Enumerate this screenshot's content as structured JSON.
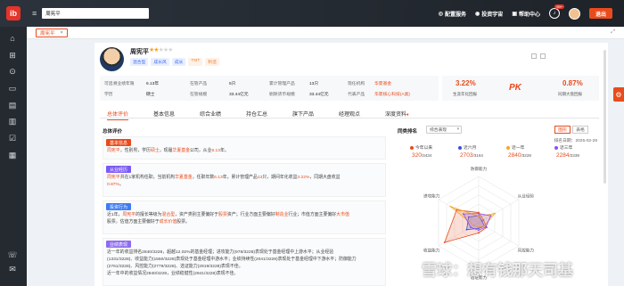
{
  "top": {
    "search_value": "周宪平",
    "links": [
      {
        "icon": "target-icon",
        "label": "配置服务"
      },
      {
        "icon": "globe-icon",
        "label": "投资宇宙"
      },
      {
        "icon": "chart-icon",
        "label": "帮助中心"
      }
    ],
    "bell_count": "99+",
    "exit_label": "退出",
    "colors": {
      "brand": "#e84b1c",
      "topbar": "#2c333c",
      "sidebar": "#252a31"
    }
  },
  "leftnav": {
    "icons": [
      "home-icon",
      "app-grid-icon",
      "compass-icon",
      "screen-icon",
      "folder-icon",
      "report-icon",
      "check-list-icon",
      "clipboard-icon",
      "phone-icon",
      "chat-icon"
    ]
  },
  "page_tab": {
    "label": "周宪平"
  },
  "manager": {
    "name": "周宪平",
    "rating": 2,
    "rating_max": 5,
    "tags": [
      "混合型",
      "成长风",
      "成长",
      "TMT",
      "制造"
    ],
    "info": {
      "row1": [
        {
          "label": "可追溯业绩年限",
          "value": "6.13年"
        },
        {
          "label": "在管产品",
          "value": "5只"
        },
        {
          "label": "累计管理产品",
          "value": "13只"
        },
        {
          "label": "现任机构",
          "value": "华夏基金"
        }
      ],
      "row2": [
        {
          "label": "学历",
          "value": "硕士"
        },
        {
          "label": "在管规模",
          "value": "33.44亿元"
        },
        {
          "label": "剔除货币规模",
          "value": "33.44亿元"
        },
        {
          "label": "代表产品",
          "value": "华夏核心科技(A类)"
        }
      ]
    },
    "kpi": {
      "annual_return": "3.22%",
      "annual_return_label": "生涯年化回报",
      "pk": "PK",
      "peer_return": "0.87%",
      "peer_return_label": "同期大盘回报"
    }
  },
  "tabs": [
    "总体评价",
    "基本信息",
    "综合业绩",
    "持仓汇总",
    "旗下产品",
    "经理观点",
    "深度资料"
  ],
  "overall": {
    "title": "总体评价",
    "blocks": [
      {
        "label": "基本信息",
        "color": "#e84b1c",
        "lines": [
          "周宪平，性别男，学历硕士，现履华夏基金公司，从业6.13年。"
        ]
      },
      {
        "label": "从业经历",
        "color": "#7a5af5",
        "lines": [
          "周宪平共在1家机构任职，当前机构华夏基金，任职年数6.13年，累计管理产品13只，期间年化收益3.22%，同期大盘收益",
          "0.87%。"
        ]
      },
      {
        "label": "投资行为",
        "color": "#3d7cf5",
        "lines": [
          "近1年，周宪平的擅长等级为混合型，资产类别主要偏好于股票资产；行业方面主要偏好制造业行业；市值方面主要偏好大市值",
          "股票，估值方面主要偏好于成长价值股票。"
        ]
      },
      {
        "label": "业绩表现",
        "color": "#8e6cf0",
        "lines": [
          "近一年的收益排名2840/3228，超越12.02%的基金经理；进攻能力(978/3228)表现处于基金经理中上游水平；从业经验",
          "(1331/3228)、收益能力(1550/3228)表现处于基金经理中游水平；业绩持续性(2041/3228)表现处于基金经理中下游水平；防御能力",
          "(2761/3228)、风控能力(2779/3228)、选证能力(2919/3228)表现不佳。",
          "近一年中的收益情况2840/3228，业绩稳健性(2941/3228)表现不佳。"
        ]
      }
    ]
  },
  "peer": {
    "title": "同类排名",
    "select": "综合表现",
    "views": [
      "图形",
      "表格"
    ],
    "rank_date": "排名日期：2025-02-28",
    "periods": [
      {
        "name": "今年以来",
        "color": "#e84b1c",
        "rank": "320",
        "total": "/3434"
      },
      {
        "name": "近六月",
        "color": "#3d4fd8",
        "rank": "2703",
        "total": "/3164"
      },
      {
        "name": "近一年",
        "color": "#f5a623",
        "rank": "2840",
        "total": "/3228"
      },
      {
        "name": "近三年",
        "color": "#8e4ef0",
        "rank": "2284",
        "total": "/2339"
      }
    ]
  },
  "chart_data": {
    "type": "radar",
    "title": "",
    "axes": [
      "防御能力",
      "从业经验",
      "风控能力",
      "选证能力",
      "收益能力",
      "进攻能力"
    ],
    "range": [
      0,
      100
    ],
    "series": [
      {
        "name": "今年以来",
        "values": [
          22,
          12,
          20,
          22,
          85,
          55
        ]
      },
      {
        "name": "近六月",
        "values": [
          15,
          8,
          14,
          12,
          30,
          25
        ]
      },
      {
        "name": "近一年",
        "values": [
          14,
          40,
          14,
          10,
          12,
          70
        ]
      },
      {
        "name": "近三年",
        "values": [
          20,
          30,
          18,
          16,
          20,
          38
        ]
      }
    ]
  },
  "watermark": "雪球：想有钱那天司基"
}
